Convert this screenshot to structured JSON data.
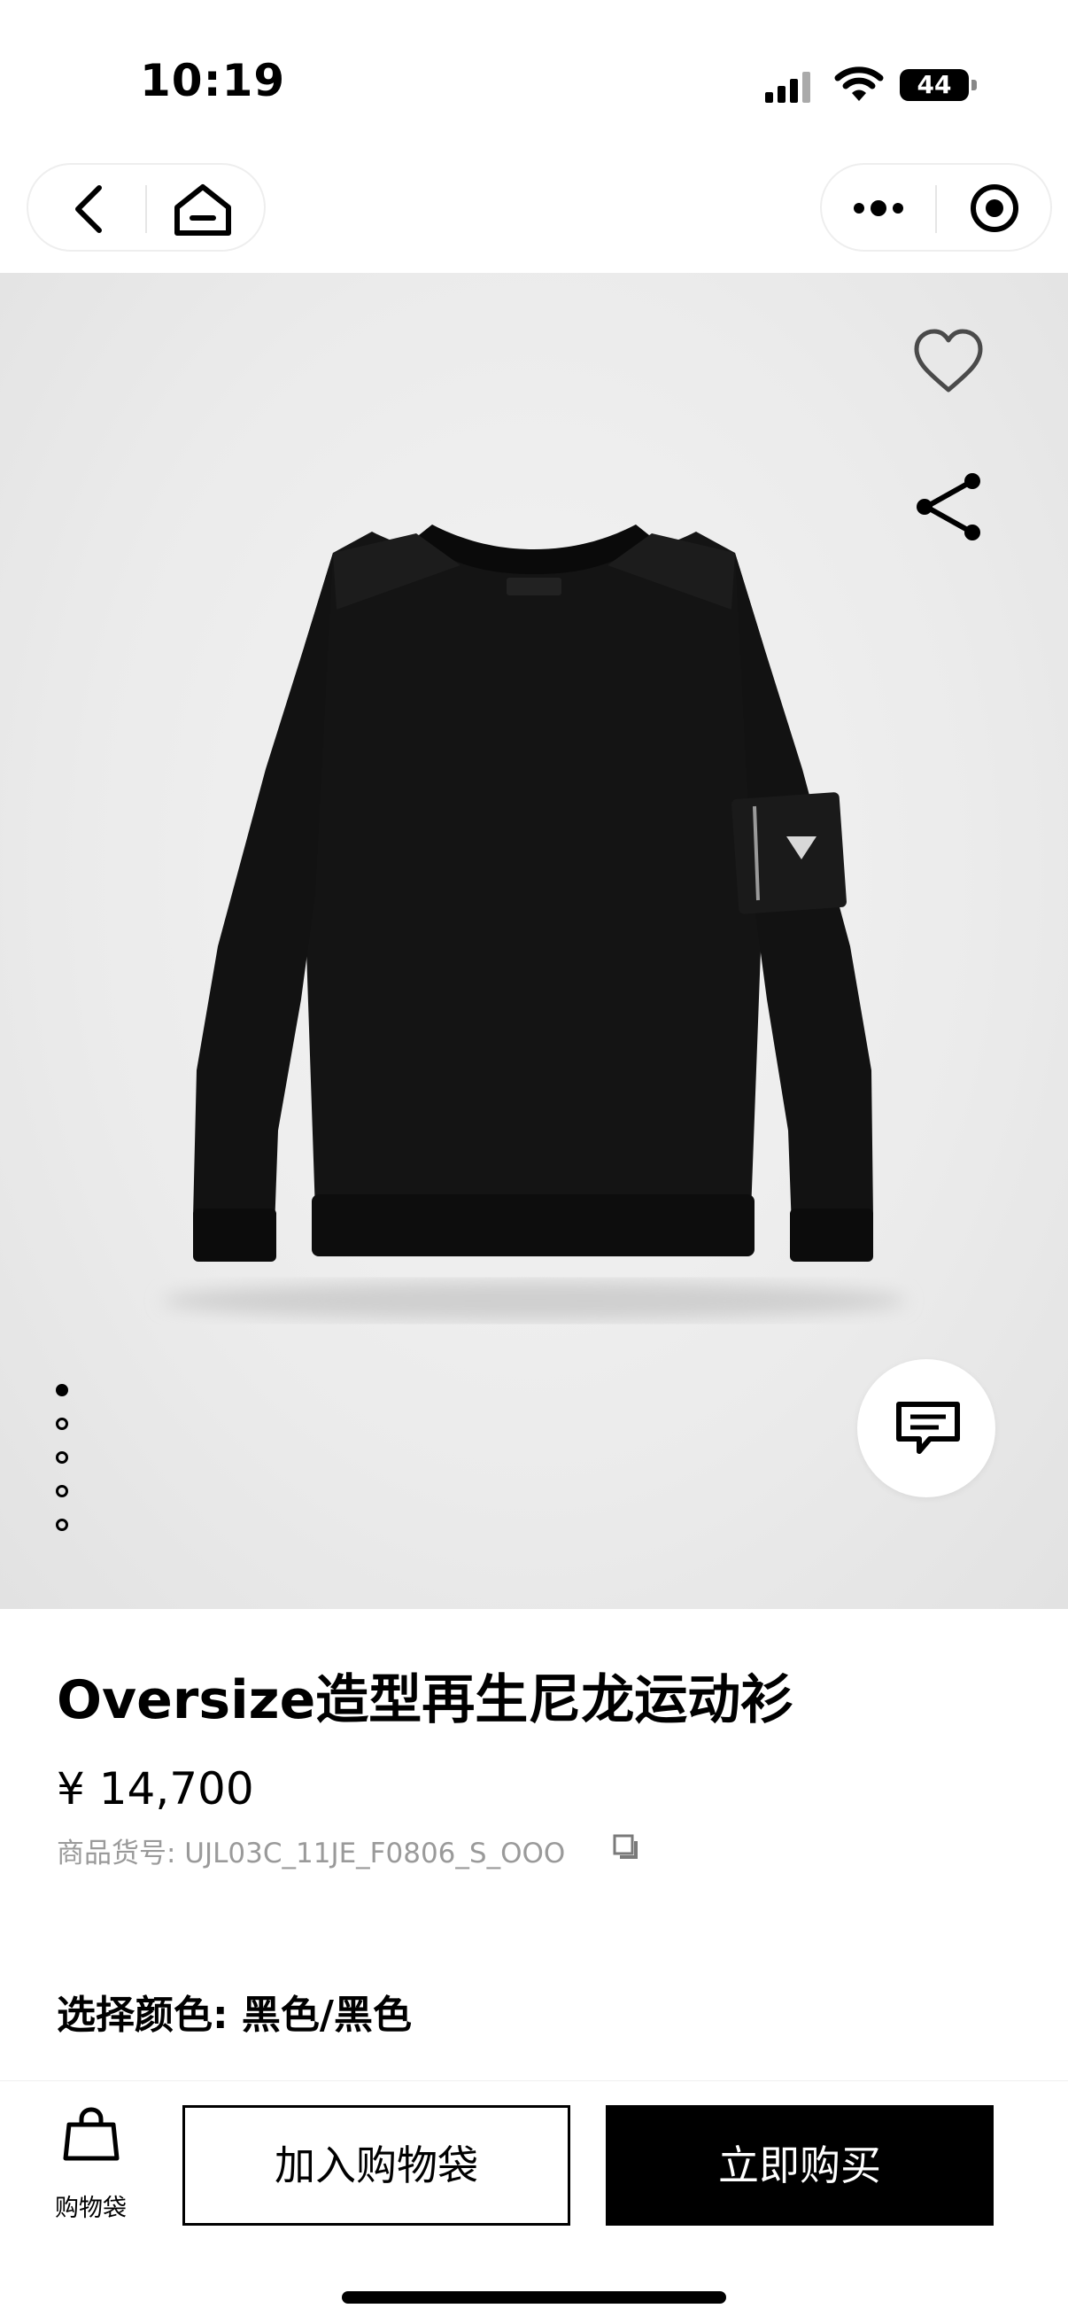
{
  "status_bar": {
    "time": "10:19",
    "battery": "44"
  },
  "nav": {
    "back_icon": "chevron-left-icon",
    "home_icon": "home-icon",
    "more_icon": "more-dots-icon",
    "close_icon": "target-close-icon"
  },
  "hero": {
    "icons": [
      "heart-icon",
      "share-icon",
      "chat-icon"
    ],
    "carousel": {
      "count": 5,
      "active_index": 0
    }
  },
  "product": {
    "title": "Oversize造型再生尼龙运动衫",
    "price": "¥ 14,700",
    "sku_label": "商品货号: UJL03C_11JE_F0806_S_OOO",
    "color_label": "选择颜色: 黑色/黑色"
  },
  "bottom_bar": {
    "bag_label": "购物袋",
    "add_to_bag": "加入购物袋",
    "buy_now": "立即购买"
  },
  "colors": {
    "accent": "#000000",
    "background": "#ffffff",
    "muted_text": "#9a9a9a"
  }
}
